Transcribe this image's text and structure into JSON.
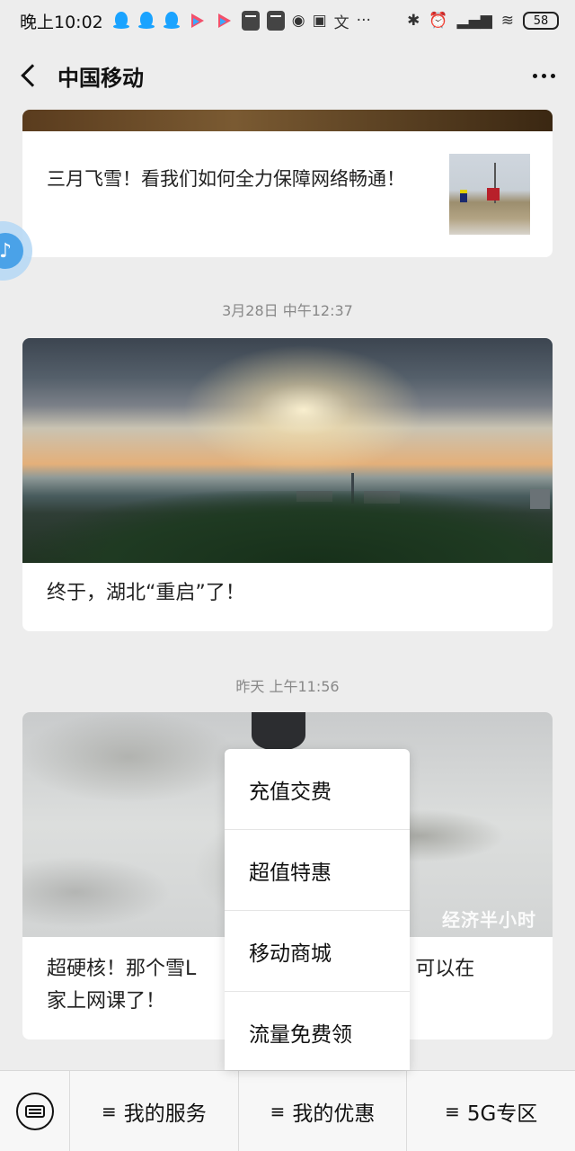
{
  "status_bar": {
    "time": "晚上10:02",
    "battery": "58",
    "notification_icons": [
      "qq-icon",
      "qq-icon",
      "qq-icon",
      "video-play-icon",
      "video-play-icon",
      "app-box-icon",
      "app-box-icon",
      "weibo-icon",
      "calendar-icon",
      "translate-icon"
    ],
    "more_glyph": "···",
    "right_icons": [
      "bluetooth-icon",
      "alarm-icon",
      "hd-signal-icon",
      "wifi-icon",
      "battery-icon"
    ]
  },
  "navbar": {
    "title": "中国移动"
  },
  "feed": {
    "card1": {
      "title": "三月飞雪！看我们如何全力保障网络畅通！"
    },
    "timestamp1": "3月28日 中午12:37",
    "card2": {
      "title": "终于，湖北“重启”了！"
    },
    "timestamp2": "昨天 上午11:56",
    "card3": {
      "title": "超硬核！那个雪L",
      "title_right": "孩，可以在",
      "title_line2": "家上网课了！",
      "watermark": "经济半小时"
    }
  },
  "popup_menu": {
    "items": [
      "充值交费",
      "超值特惠",
      "移动商城",
      "流量免费领"
    ]
  },
  "bottom_bar": {
    "hamburger": "≡",
    "tabs": [
      "我的服务",
      "我的优惠",
      "5G专区"
    ]
  }
}
